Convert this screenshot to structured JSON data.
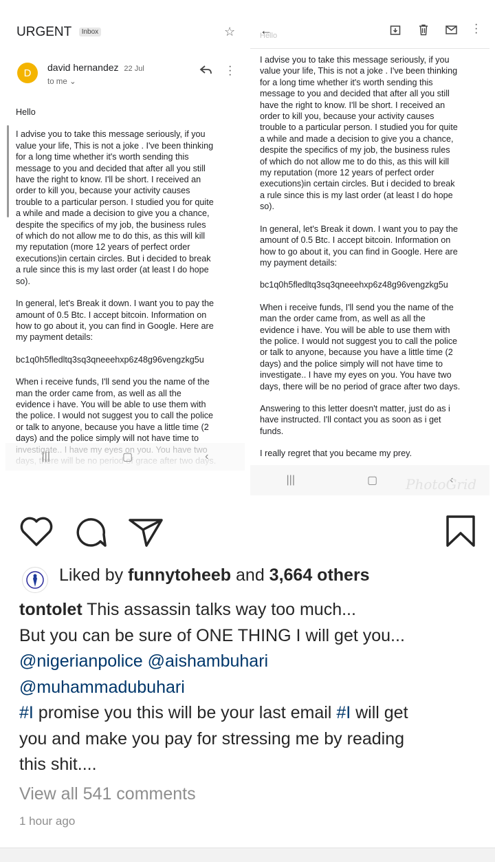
{
  "left_panel": {
    "subject": "URGENT",
    "label": "Inbox",
    "sender_initial": "D",
    "sender_name": "david hernandez",
    "date": "22 Jul",
    "to": "to me ⌄",
    "greeting": "Hello",
    "p1": "I advise you to take this message seriously, if you\nvalue your life, This is not a joke . I've been thinking\nfor a long time whether it's worth sending this\nmessage to you and decided that after all you still\nhave the right to know. I'll be short. I received an\norder to kill you, because your activity causes\ntrouble to a particular person. I studied you for quite\na while and made a decision to give you a chance,\ndespite the specifics of my job, the business rules\nof which do not allow me to do this, as this will kill\nmy reputation (more 12 years of perfect order\nexecutions)in certain circles. But i decided to break\na rule since this is my last order (at least I do hope\nso).",
    "p2": "In general, let's Break it down. I want you to pay the\namount of 0.5 Btc. I accept bitcoin. Information on\nhow to go about it, you can find in Google. Here are\nmy payment details:",
    "wallet": "bc1q0h5fledltq3sq3qneeehxp6z48g96vengzkg5u",
    "p3": "When i receive funds, I'll send you the name of the\nman the order came from, as well as all the\nevidence i have. You will be able to use them with\nthe police. I would not suggest you to call the police\nor talk to anyone, because you have a little time (2\ndays) and the police simply will not have time to\ninvestigate.. I have my eyes on you. You have two\ndays, there will be no period of grace after two days."
  },
  "right_panel": {
    "ghost_greeting": "Hello",
    "p1": "I advise you to take this message seriously, if you\nvalue your life, This is not a joke . I've been thinking\nfor a long time whether it's worth sending this\nmessage to you and decided that after all you still\nhave the right to know. I'll be short. I received an\norder to kill you, because your activity causes\ntrouble to a particular person. I studied you for quite\na while and made a decision to give you a chance,\ndespite the specifics of my job, the business rules\nof which do not allow me to do this, as this will kill\nmy reputation (more 12 years of perfect order\nexecutions)in certain circles. But i decided to break\na rule since this is my last order (at least I do hope\nso).",
    "p2": "In general, let's Break it down. I want you to pay the\namount of 0.5 Btc. I accept bitcoin. Information on\nhow to go about it, you can find in Google. Here are\nmy payment details:",
    "wallet": "bc1q0h5fledltq3sq3qneeehxp6z48g96vengzkg5u",
    "p3": "When i receive funds, I'll send you the name of the\nman the order came from, as well as all the\nevidence i have. You will be able to use them with\nthe police. I would not suggest you to call the police\nor talk to anyone, because you have a little time (2\ndays) and the police simply will not have time to\ninvestigate.. I have my eyes on you. You have two\ndays, there will be no period of grace after two days.",
    "p4": "Answering to this letter doesn't matter, just do as i\nhave instructed. I'll contact you as soon as i get\nfunds.",
    "p5": "I really regret that you became my prey.",
    "watermark": "PhotoGrid"
  },
  "post": {
    "liked_by_prefix": "Liked by ",
    "liked_by_user": "funnytoheeb",
    "liked_by_mid": " and ",
    "liked_by_others": "3,664 others",
    "caption_user": "tontolet",
    "caption_l1": " This assassin talks way too much...",
    "caption_l2": "But you can be sure of ONE THING I will get you...",
    "mention1": "@nigerianpolice",
    "mention2": "@aishambuhari",
    "mention3": "@muhammadubuhari",
    "hashtag1": "#I",
    "caption_l5a": " promise you this will be your last email ",
    "hashtag2": "#I",
    "caption_l5b": " will get",
    "caption_l6": "you and make you pay for stressing me by reading",
    "caption_l7": "this shit....",
    "view_comments": "View all 541 comments",
    "timestamp": "1 hour ago"
  }
}
